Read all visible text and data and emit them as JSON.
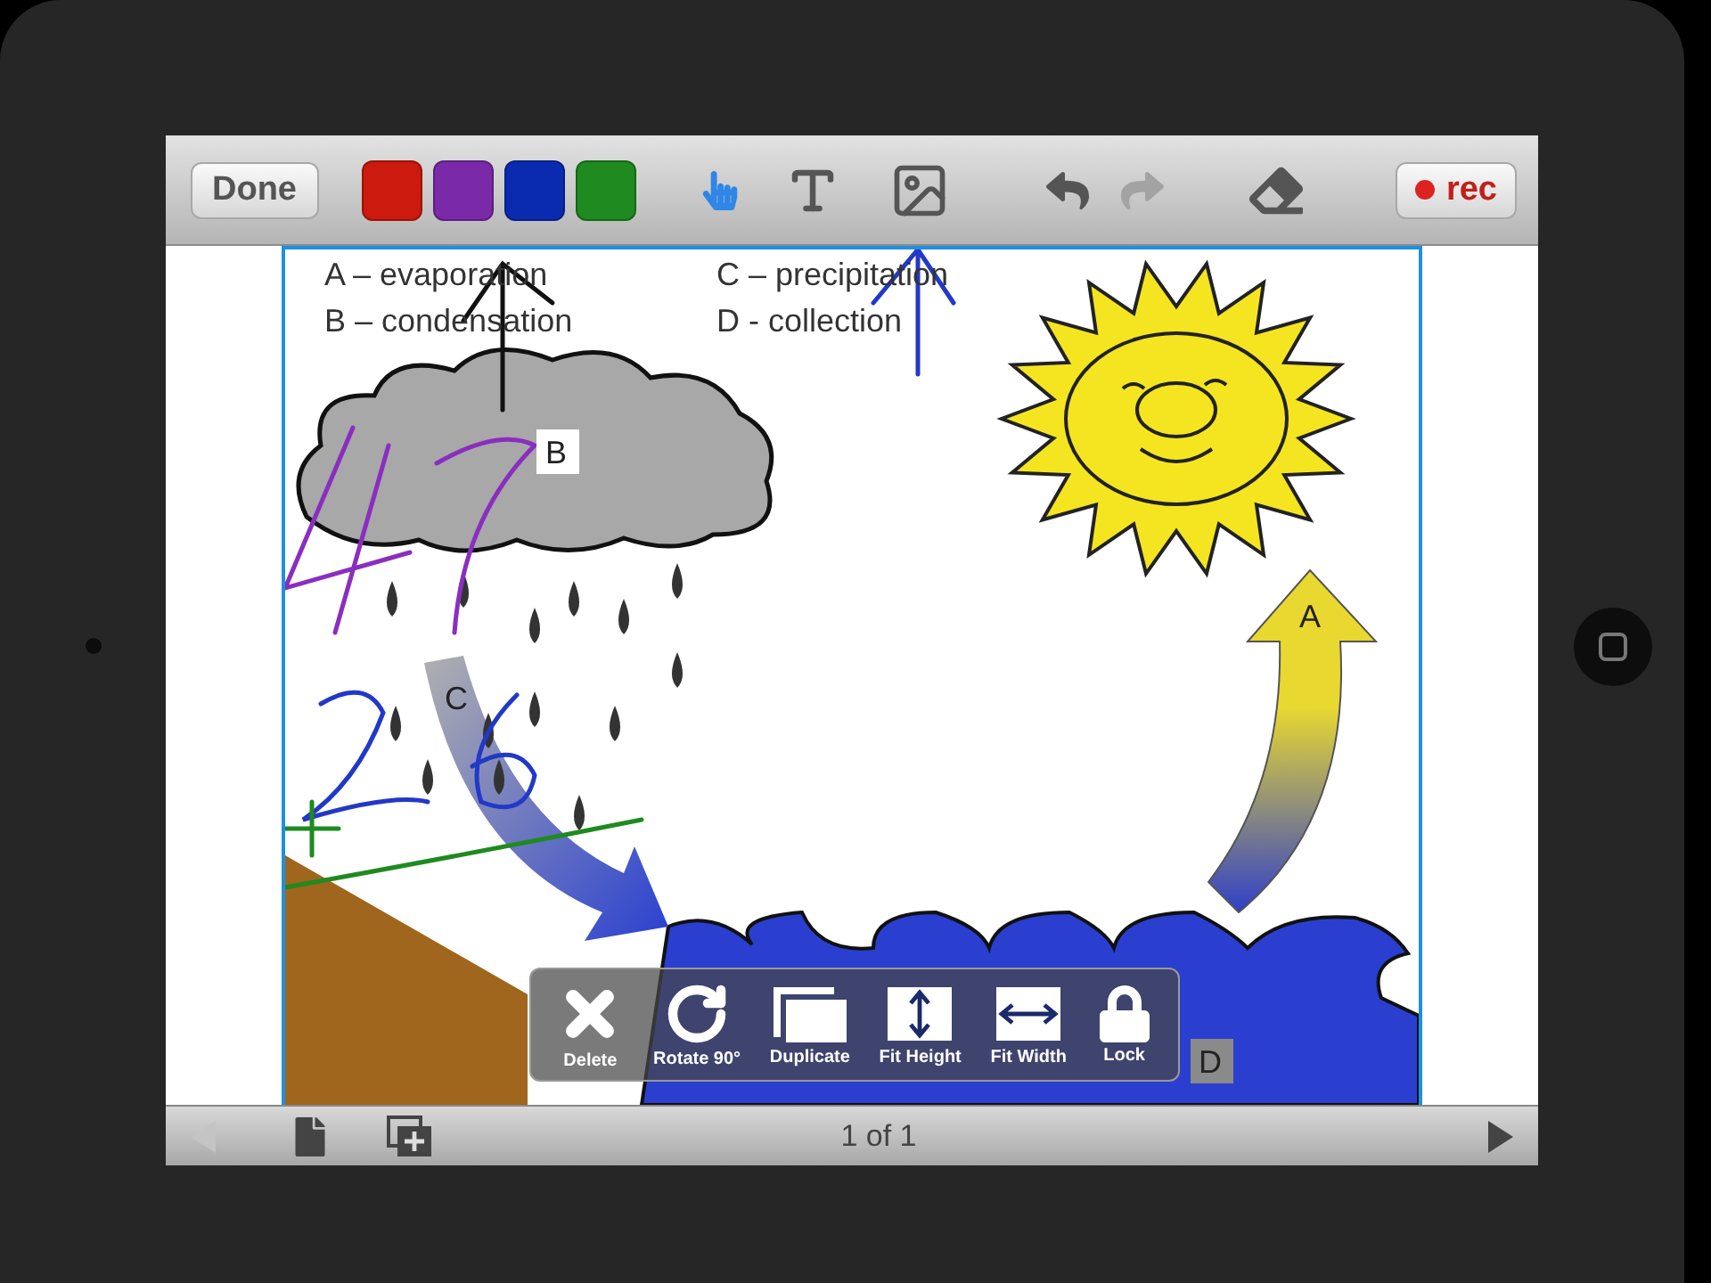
{
  "toolbar": {
    "done": "Done",
    "colors": [
      {
        "color": "#cc1a0e"
      },
      {
        "color": "#7a2aa8"
      },
      {
        "color": "#0a2bb0"
      },
      {
        "color": "#1f8a1f"
      }
    ],
    "tools": [
      {
        "kind": "pointer",
        "selected": true
      },
      {
        "kind": "text",
        "selected": false
      },
      {
        "kind": "image",
        "selected": false
      }
    ],
    "history": [
      {
        "kind": "undo",
        "disabled": false
      },
      {
        "kind": "redo",
        "disabled": true
      }
    ],
    "record": "rec"
  },
  "canvas": {
    "legend": [
      "A – evaporation",
      "B – condensation",
      "C – precipitation",
      "D - collection"
    ],
    "diagram_labels": [
      "A",
      "B",
      "C",
      "D"
    ]
  },
  "action_bar": [
    {
      "kind": "delete",
      "label": "Delete"
    },
    {
      "kind": "rotate",
      "label": "Rotate 90°"
    },
    {
      "kind": "duplicate",
      "label": "Duplicate"
    },
    {
      "kind": "fit_height",
      "label": "Fit Height"
    },
    {
      "kind": "fit_width",
      "label": "Fit Width"
    },
    {
      "kind": "lock",
      "label": "Lock"
    }
  ],
  "bottom_bar": {
    "previous_disabled": true,
    "next_disabled": false,
    "page": "1 of 1"
  }
}
